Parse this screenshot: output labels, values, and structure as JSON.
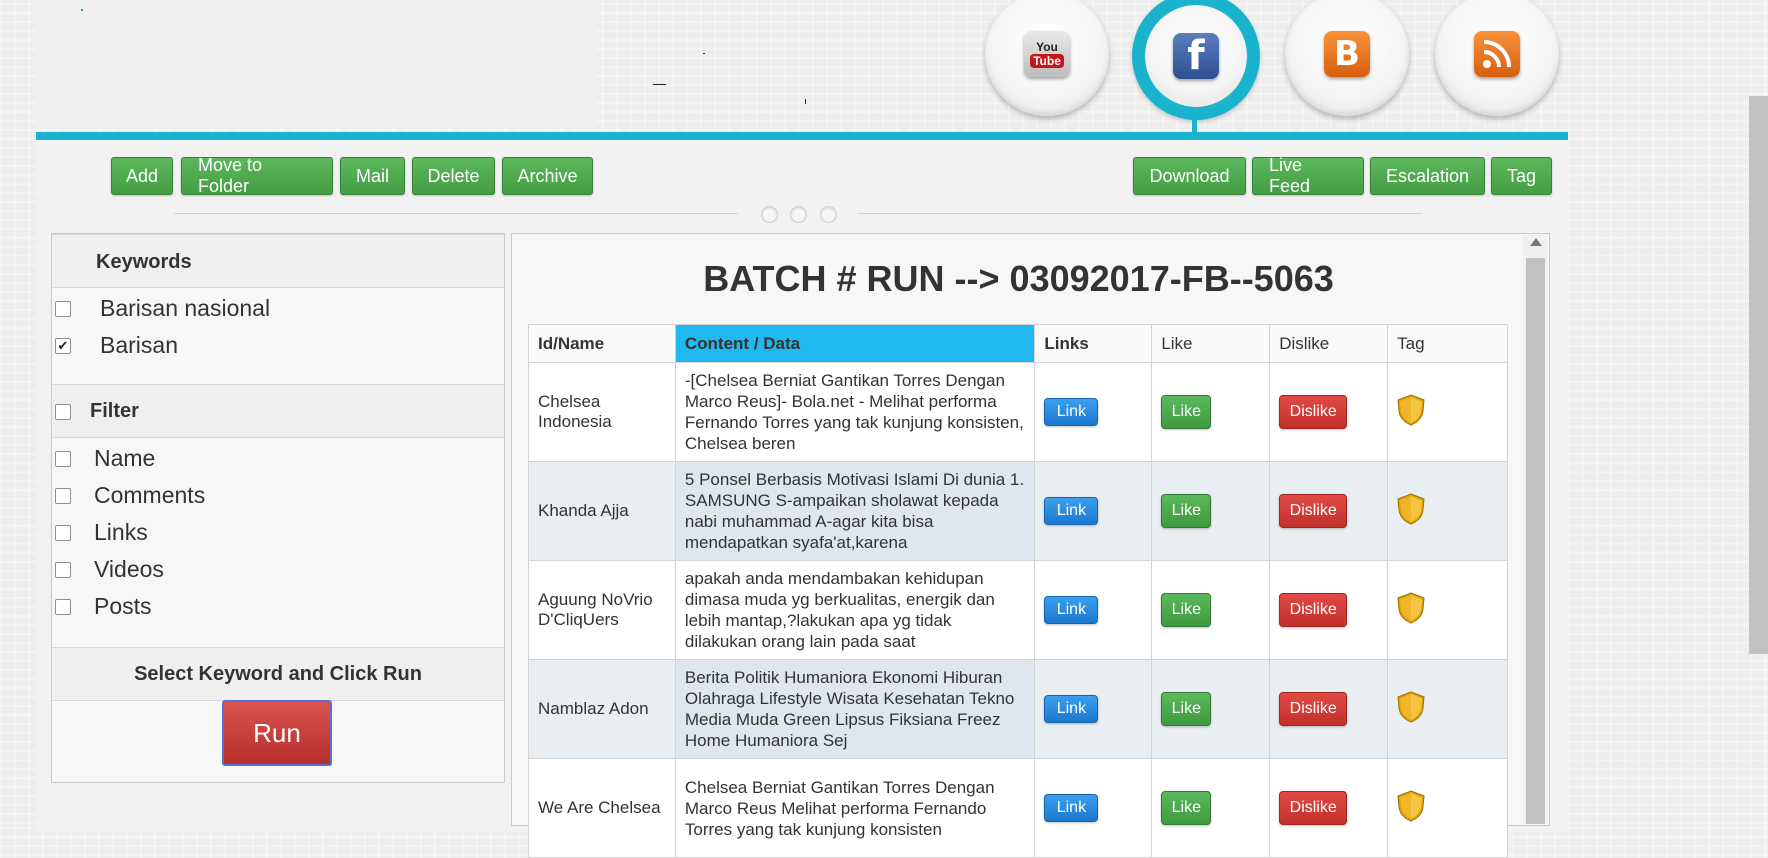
{
  "social": [
    {
      "name": "youtube-icon",
      "glyph_top": "You",
      "glyph_bottom": "Tube"
    },
    {
      "name": "facebook-icon",
      "glyph": "f"
    },
    {
      "name": "blogger-icon",
      "glyph": "B"
    },
    {
      "name": "rss-icon"
    }
  ],
  "toolbar_left": [
    "Add",
    "Move to Folder",
    "Mail",
    "Delete",
    "Archive"
  ],
  "toolbar_right": [
    "Download",
    "Live Feed",
    "Escalation",
    "Tag"
  ],
  "keywords": {
    "title": "Keywords",
    "items": [
      {
        "label": "Barisan nasional",
        "checked": false
      },
      {
        "label": "Barisan",
        "checked": true
      }
    ]
  },
  "filter": {
    "title": "Filter",
    "checked": false,
    "items": [
      {
        "label": "Name",
        "checked": false
      },
      {
        "label": "Comments",
        "checked": false
      },
      {
        "label": "Links",
        "checked": false
      },
      {
        "label": "Videos",
        "checked": false
      },
      {
        "label": "Posts",
        "checked": false
      }
    ]
  },
  "run_section": {
    "title": "Select Keyword and Click Run",
    "button": "Run"
  },
  "batch_title": "BATCH # RUN --> 03092017-FB--5063",
  "table": {
    "headers": [
      "Id/Name",
      "Content / Data",
      "Links",
      "Like",
      "Dislike",
      "Tag"
    ],
    "link_label": "Link",
    "like_label": "Like",
    "dislike_label": "Dislike",
    "rows": [
      {
        "name": "Chelsea Indonesia",
        "content": "-[Chelsea Berniat Gantikan Torres Dengan Marco Reus]- Bola.net - Melihat performa Fernando Torres yang tak kunjung konsisten, Chelsea beren"
      },
      {
        "name": "Khanda Ajja",
        "content": "5 Ponsel Berbasis Motivasi Islami Di dunia 1. SAMSUNG S-ampaikan sholawat kepada nabi muhammad A-agar kita bisa mendapatkan syafa'at,karena"
      },
      {
        "name": "Aguung NoVrio D'CliqUers",
        "content": "apakah anda mendambakan kehidupan dimasa muda yg berkualitas, energik dan lebih mantap,?lakukan apa yg tidak dilakukan orang lain pada saat"
      },
      {
        "name": "Namblaz Adon",
        "content": "Berita Politik Humaniora Ekonomi Hiburan Olahraga Lifestyle Wisata Kesehatan Tekno Media Muda Green Lipsus Fiksiana Freez Home Humaniora Sej"
      },
      {
        "name": "We Are Chelsea",
        "content": "Chelsea Berniat Gantikan Torres Dengan Marco Reus Melihat performa Fernando Torres yang tak kunjung konsisten"
      }
    ]
  },
  "colors": {
    "accent": "#19b3cd",
    "green": "#5cb85c",
    "red": "#d9534f",
    "header_highlight": "#21b8ef",
    "link_blue": "#2a8ce0"
  }
}
